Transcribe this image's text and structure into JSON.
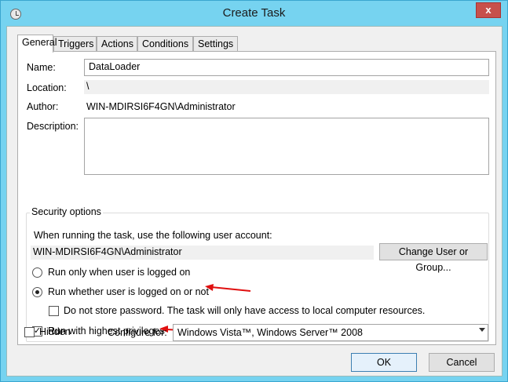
{
  "window": {
    "title": "Create Task",
    "close_glyph": "x"
  },
  "tabs": [
    {
      "label": "General"
    },
    {
      "label": "Triggers"
    },
    {
      "label": "Actions"
    },
    {
      "label": "Conditions"
    },
    {
      "label": "Settings"
    }
  ],
  "general": {
    "name_label": "Name:",
    "name_value": "DataLoader",
    "location_label": "Location:",
    "location_value": "\\",
    "author_label": "Author:",
    "author_value": "WIN-MDIRSI6F4GN\\Administrator",
    "description_label": "Description:",
    "description_value": ""
  },
  "security": {
    "title": "Security options",
    "account_prompt": "When running the task, use the following user account:",
    "account_value": "WIN-MDIRSI6F4GN\\Administrator",
    "change_button": "Change User or Group...",
    "run_logged_on": "Run only when user is logged on",
    "run_whether": "Run whether user is logged on or not",
    "no_store_password": "Do not store password.  The task will only have access to local computer resources.",
    "highest_privileges": "Run with highest privileges",
    "selected_option": "run_whether",
    "no_store_checked": false,
    "highest_checked": true
  },
  "bottom": {
    "hidden_label": "Hidden",
    "hidden_checked": false,
    "configure_label": "Configure for:",
    "configure_value": "Windows Vista™, Windows Server™ 2008"
  },
  "buttons": {
    "ok": "OK",
    "cancel": "Cancel"
  },
  "colors": {
    "annotation_arrow": "#e01010",
    "title_bar": "#76d3f0"
  },
  "icons": [
    "clock-icon",
    "close-icon",
    "dropdown-arrow-icon",
    "check-icon"
  ]
}
